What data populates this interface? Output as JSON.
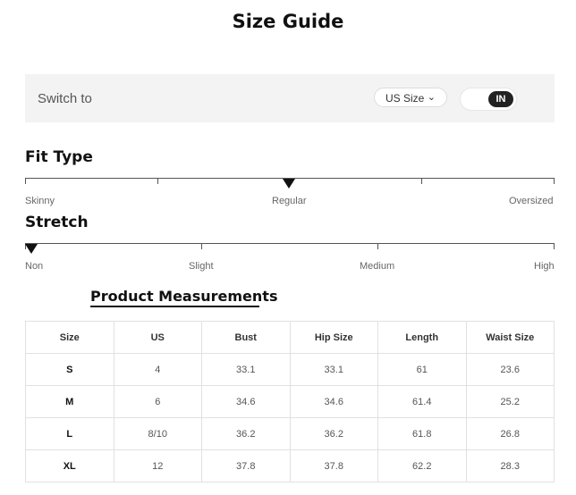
{
  "title": "Size Guide",
  "switch": {
    "label": "Switch to",
    "size_select": "US Size",
    "toggle": "IN"
  },
  "fit_type": {
    "heading": "Fit Type",
    "labels": [
      "Skinny",
      "Regular",
      "Oversized"
    ],
    "selected": "Regular"
  },
  "stretch": {
    "heading": "Stretch",
    "labels": [
      "Non",
      "Slight",
      "Medium",
      "High"
    ],
    "selected": "Non"
  },
  "measurements": {
    "heading": "Product Measurements",
    "columns": [
      "Size",
      "US",
      "Bust",
      "Hip Size",
      "Length",
      "Waist Size"
    ],
    "rows": [
      [
        "S",
        "4",
        "33.1",
        "33.1",
        "61",
        "23.6"
      ],
      [
        "M",
        "6",
        "34.6",
        "34.6",
        "61.4",
        "25.2"
      ],
      [
        "L",
        "8/10",
        "36.2",
        "36.2",
        "61.8",
        "26.8"
      ],
      [
        "XL",
        "12",
        "37.8",
        "37.8",
        "62.2",
        "28.3"
      ]
    ]
  }
}
